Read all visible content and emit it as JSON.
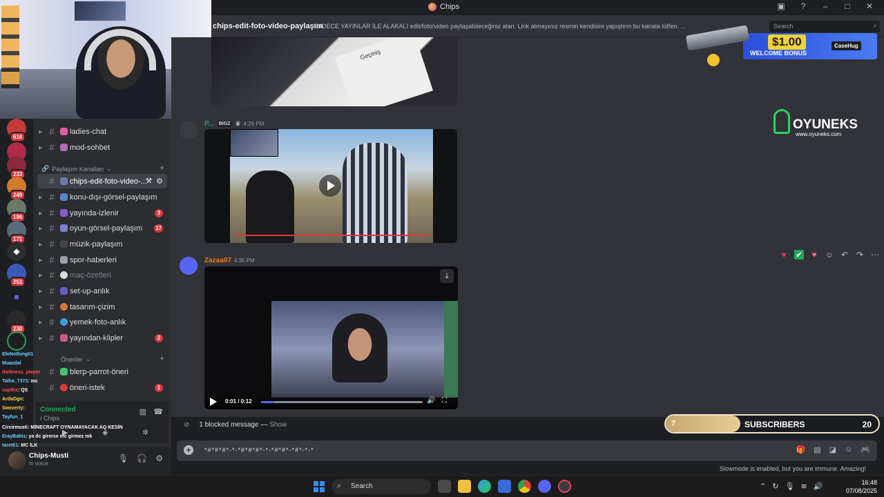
{
  "window": {
    "title": "Chips"
  },
  "header": {
    "channel_name": "chips-edit-foto-video-paylaşım",
    "topic": "SADECE YAYINLAR İLE ALAKALI edit/foto/video paylaşabileceğiniz alan. Link atmayınız resmin kendisini yapıştırın bu kanala lütfen. ...",
    "search_placeholder": "Search"
  },
  "rail": {
    "badges": [
      "616",
      "233",
      "249",
      "196",
      "171",
      "251",
      "230"
    ]
  },
  "channels": {
    "items_top": [
      {
        "name": "ladies-chat",
        "emoji_color": "#e05fa5"
      },
      {
        "name": "mod-sohbet",
        "emoji_color": "#b06ab3"
      }
    ],
    "category1": "Paylaşım Kanalları",
    "items": [
      {
        "name": "chips-edit-foto-video-...",
        "count": "",
        "active": true,
        "emoji_color": "#6d7aa8"
      },
      {
        "name": "konu-dışı-görsel-paylaşım",
        "count": "",
        "emoji_color": "#5a86c8"
      },
      {
        "name": "yayında-izlenir",
        "count": "3",
        "emoji_color": "#8a5ac8"
      },
      {
        "name": "oyun-görsel-paylaşım",
        "count": "17",
        "emoji_color": "#7a7fd0"
      },
      {
        "name": "müzik-paylaşım",
        "count": "",
        "emoji_color": "#444",
        "muted_label": true
      },
      {
        "name": "spor-haberleri",
        "count": "",
        "emoji_color": "#9aa0aa"
      },
      {
        "name": "maç-özetleri",
        "count": "",
        "emoji_color": "#dcdcdc",
        "muted": true
      },
      {
        "name": "set-up-anlık",
        "count": "",
        "emoji_color": "#6060c0"
      },
      {
        "name": "tasarım-çizim",
        "count": "",
        "emoji_color": "#d87a3a"
      },
      {
        "name": "yemek-foto-anlık",
        "count": "",
        "emoji_color": "#3aa0d8"
      },
      {
        "name": "yayından-klipler",
        "count": "2",
        "emoji_color": "#c85a8a"
      }
    ],
    "category2": "Öneriler",
    "items_bottom": [
      {
        "name": "blerp-parrot-öneri",
        "count": "",
        "emoji_color": "#4ac070"
      },
      {
        "name": "öneri-istek",
        "count": "1",
        "emoji_color": "#d83a3a"
      }
    ]
  },
  "voice": {
    "status": "Connected",
    "channel": "/ Chips"
  },
  "user": {
    "name": "Chips-Musti",
    "status": "In voice"
  },
  "stream_chat": [
    {
      "user": "EfeNothing01",
      "text": ""
    },
    {
      "user": "Muazdal",
      "text": ""
    },
    {
      "user": "darkness_player",
      "text": ""
    },
    {
      "user": "Talha_7373",
      "text": ": mc"
    },
    {
      "user": "supthx",
      "text": ": QS"
    },
    {
      "user": "ArdaDgn",
      "text": ":"
    },
    {
      "user": "Swezerty",
      "text": ":"
    },
    {
      "user": "Tayfun_1",
      "text": ""
    },
    {
      "user": "Circirmusti",
      "text": ": MİNECRAFT OYNAMAYACAK AQ KESİN"
    },
    {
      "user": "ErayBabis",
      "text": ": ya dc girerse mc girmez mk"
    },
    {
      "user": "taret61",
      "text": ": MC İLK"
    }
  ],
  "messages": [
    {
      "author": "P...",
      "tag": "BIGZ",
      "time": "4:26 PM",
      "author_color": "#23a55a"
    },
    {
      "author": "Zazaa07",
      "tag": "",
      "time": "4:35 PM",
      "author_color": "#e67e22"
    }
  ],
  "media1": {
    "paper_text": "Geçmiş"
  },
  "video": {
    "time": "0:01 / 0:12",
    "progress": 0.0833
  },
  "reactions": [
    "♥",
    "✔",
    "♥",
    "☺",
    "↶",
    "↷",
    "⋯"
  ],
  "blocked": {
    "text": "1 blocked message —",
    "show": "Show"
  },
  "composer": {
    "text": "*#*#*#*-*-*#*#*#*-*-*#*#*-*#*-*-*"
  },
  "slowmode": "Slowmode is enabled, but you are immune. Amazing!",
  "promo": {
    "amount": "$1.00",
    "bonus": "WELCOME BONUS",
    "brand": "CaseHug"
  },
  "sponsor": {
    "name": "OYUNEKS",
    "url": "www.oyuneks.com"
  },
  "subs": {
    "count": "7",
    "label": "SUBSCRIBERS",
    "goal": "20",
    "progress": 0.35
  },
  "taskbar": {
    "search": "Search",
    "time": "16:48",
    "date": "07/08/2025"
  }
}
